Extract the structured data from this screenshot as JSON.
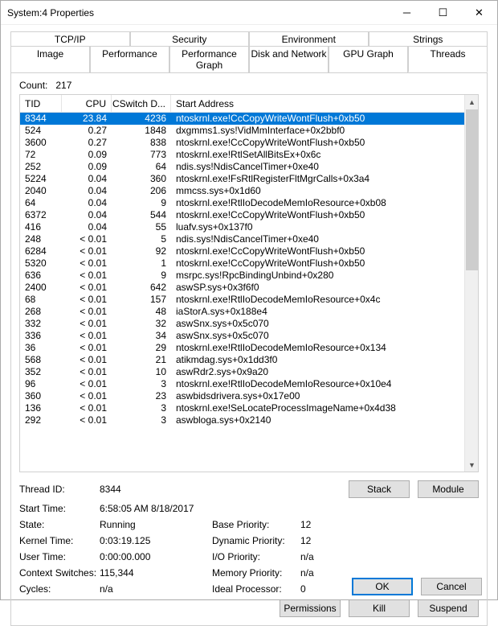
{
  "window": {
    "title": "System:4 Properties"
  },
  "tabs_row1": [
    "TCP/IP",
    "Security",
    "Environment",
    "Strings"
  ],
  "tabs_row2": [
    "Image",
    "Performance",
    "Performance Graph",
    "Disk and Network",
    "GPU Graph",
    "Threads"
  ],
  "active_tab": "Threads",
  "count_label": "Count:",
  "count_value": "217",
  "columns": {
    "tid": "TID",
    "cpu": "CPU",
    "csw": "CSwitch D...",
    "addr": "Start Address"
  },
  "rows": [
    {
      "tid": "8344",
      "cpu": "23.84",
      "csw": "4236",
      "addr": "ntoskrnl.exe!CcCopyWriteWontFlush+0xb50",
      "sel": true
    },
    {
      "tid": "524",
      "cpu": "0.27",
      "csw": "1848",
      "addr": "dxgmms1.sys!VidMmInterface+0x2bbf0"
    },
    {
      "tid": "3600",
      "cpu": "0.27",
      "csw": "838",
      "addr": "ntoskrnl.exe!CcCopyWriteWontFlush+0xb50"
    },
    {
      "tid": "72",
      "cpu": "0.09",
      "csw": "773",
      "addr": "ntoskrnl.exe!RtlSetAllBitsEx+0x6c"
    },
    {
      "tid": "252",
      "cpu": "0.09",
      "csw": "64",
      "addr": "ndis.sys!NdisCancelTimer+0xe40"
    },
    {
      "tid": "5224",
      "cpu": "0.04",
      "csw": "360",
      "addr": "ntoskrnl.exe!FsRtlRegisterFltMgrCalls+0x3a4"
    },
    {
      "tid": "2040",
      "cpu": "0.04",
      "csw": "206",
      "addr": "mmcss.sys+0x1d60"
    },
    {
      "tid": "64",
      "cpu": "0.04",
      "csw": "9",
      "addr": "ntoskrnl.exe!RtlIoDecodeMemIoResource+0xb08"
    },
    {
      "tid": "6372",
      "cpu": "0.04",
      "csw": "544",
      "addr": "ntoskrnl.exe!CcCopyWriteWontFlush+0xb50"
    },
    {
      "tid": "416",
      "cpu": "0.04",
      "csw": "55",
      "addr": "luafv.sys+0x137f0"
    },
    {
      "tid": "248",
      "cpu": "< 0.01",
      "csw": "5",
      "addr": "ndis.sys!NdisCancelTimer+0xe40"
    },
    {
      "tid": "6284",
      "cpu": "< 0.01",
      "csw": "92",
      "addr": "ntoskrnl.exe!CcCopyWriteWontFlush+0xb50"
    },
    {
      "tid": "5320",
      "cpu": "< 0.01",
      "csw": "1",
      "addr": "ntoskrnl.exe!CcCopyWriteWontFlush+0xb50"
    },
    {
      "tid": "636",
      "cpu": "< 0.01",
      "csw": "9",
      "addr": "msrpc.sys!RpcBindingUnbind+0x280"
    },
    {
      "tid": "2400",
      "cpu": "< 0.01",
      "csw": "642",
      "addr": "aswSP.sys+0x3f6f0"
    },
    {
      "tid": "68",
      "cpu": "< 0.01",
      "csw": "157",
      "addr": "ntoskrnl.exe!RtlIoDecodeMemIoResource+0x4c"
    },
    {
      "tid": "268",
      "cpu": "< 0.01",
      "csw": "48",
      "addr": "iaStorA.sys+0x188e4"
    },
    {
      "tid": "332",
      "cpu": "< 0.01",
      "csw": "32",
      "addr": "aswSnx.sys+0x5c070"
    },
    {
      "tid": "336",
      "cpu": "< 0.01",
      "csw": "34",
      "addr": "aswSnx.sys+0x5c070"
    },
    {
      "tid": "36",
      "cpu": "< 0.01",
      "csw": "29",
      "addr": "ntoskrnl.exe!RtlIoDecodeMemIoResource+0x134"
    },
    {
      "tid": "568",
      "cpu": "< 0.01",
      "csw": "21",
      "addr": "atikmdag.sys+0x1dd3f0"
    },
    {
      "tid": "352",
      "cpu": "< 0.01",
      "csw": "10",
      "addr": "aswRdr2.sys+0x9a20"
    },
    {
      "tid": "96",
      "cpu": "< 0.01",
      "csw": "3",
      "addr": "ntoskrnl.exe!RtlIoDecodeMemIoResource+0x10e4"
    },
    {
      "tid": "360",
      "cpu": "< 0.01",
      "csw": "23",
      "addr": "aswbidsdrivera.sys+0x17e00"
    },
    {
      "tid": "136",
      "cpu": "< 0.01",
      "csw": "3",
      "addr": "ntoskrnl.exe!SeLocateProcessImageName+0x4d38"
    },
    {
      "tid": "292",
      "cpu": "< 0.01",
      "csw": "3",
      "addr": "aswbloga.sys+0x2140"
    }
  ],
  "detail_labels": {
    "thread_id": "Thread ID:",
    "start_time": "Start Time:",
    "state": "State:",
    "kernel_time": "Kernel Time:",
    "user_time": "User Time:",
    "ctx": "Context Switches:",
    "cycles": "Cycles:",
    "base_pri": "Base Priority:",
    "dyn_pri": "Dynamic Priority:",
    "io_pri": "I/O Priority:",
    "mem_pri": "Memory Priority:",
    "ideal": "Ideal Processor:"
  },
  "detail_values": {
    "thread_id": "8344",
    "start_time": "6:58:05 AM   8/18/2017",
    "state": "Running",
    "kernel_time": "0:03:19.125",
    "user_time": "0:00:00.000",
    "ctx": "115,344",
    "cycles": "n/a",
    "base_pri": "12",
    "dyn_pri": "12",
    "io_pri": "n/a",
    "mem_pri": "n/a",
    "ideal": "0"
  },
  "buttons": {
    "stack": "Stack",
    "module": "Module",
    "permissions": "Permissions",
    "kill": "Kill",
    "suspend": "Suspend",
    "ok": "OK",
    "cancel": "Cancel"
  }
}
